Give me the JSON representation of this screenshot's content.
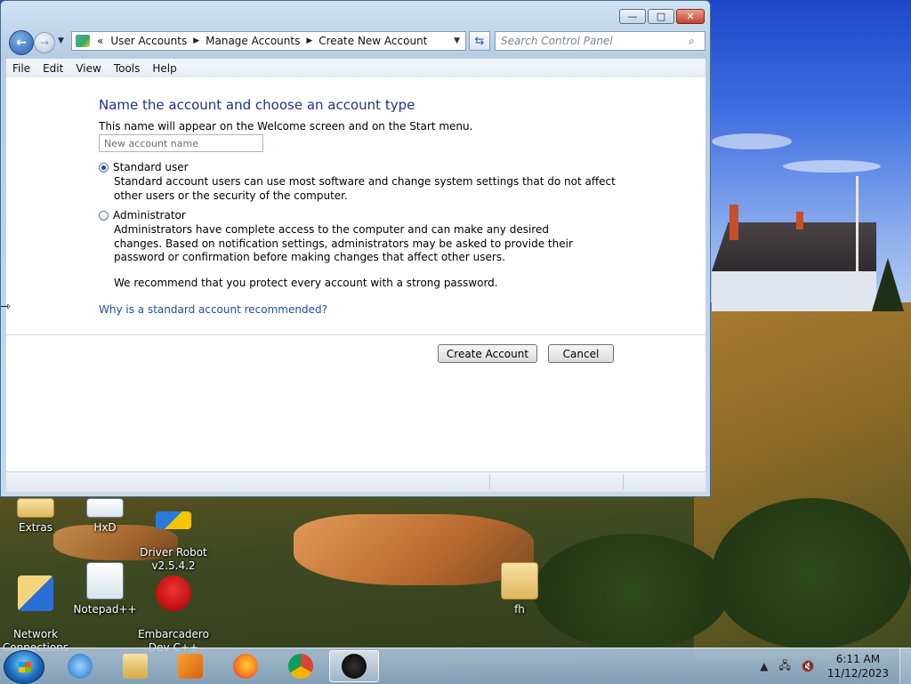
{
  "window": {
    "buttons": {
      "minimize": "—",
      "maximize": "□",
      "close": "✕"
    }
  },
  "address_bar": {
    "chevron": "«",
    "crumbs": [
      "User Accounts",
      "Manage Accounts",
      "Create New Account"
    ],
    "separator": "▶",
    "dropdown": "▼"
  },
  "search": {
    "placeholder": "Search Control Panel"
  },
  "menu": [
    "File",
    "Edit",
    "View",
    "Tools",
    "Help"
  ],
  "content": {
    "heading": "Name the account and choose an account type",
    "subtext": "This name will appear on the Welcome screen and on the Start menu.",
    "name_placeholder": "New account name",
    "options": [
      {
        "label": "Standard user",
        "selected": true,
        "description": "Standard account users can use most software and change system settings that do not affect other users or the security of the computer."
      },
      {
        "label": "Administrator",
        "selected": false,
        "description": "Administrators have complete access to the computer and can make any desired changes. Based on notification settings, administrators may be asked to provide their password or confirmation before making changes that affect other users."
      }
    ],
    "recommendation": "We recommend that you protect every account with a strong password.",
    "help_link": "Why is a standard account recommended?",
    "create_button": "Create Account",
    "cancel_button": "Cancel"
  },
  "desktop_icons": [
    {
      "label": "Extras",
      "icon": "folder-icon"
    },
    {
      "label": "HxD",
      "icon": "hex-editor-icon"
    },
    {
      "label": "Driver Robot\nv2.5.4.2",
      "icon": "driver-robot-icon"
    },
    {
      "label": "Network\nConnections",
      "icon": "network-icon"
    },
    {
      "label": "Notepad++",
      "icon": "notepad-icon"
    },
    {
      "label": "Embarcadero\nDev-C++",
      "icon": "devcpp-icon"
    },
    {
      "label": "fh",
      "icon": "folder-icon"
    }
  ],
  "taskbar": {
    "items": [
      "internet-explorer-icon",
      "file-explorer-icon",
      "media-player-icon",
      "firefox-icon",
      "chrome-icon",
      "active-app-icon"
    ],
    "time": "6:11 AM",
    "date": "11/12/2023"
  },
  "colors": {
    "heading": "#1e3287",
    "link": "#1e4e9c",
    "taskbar": "#8caac8"
  }
}
